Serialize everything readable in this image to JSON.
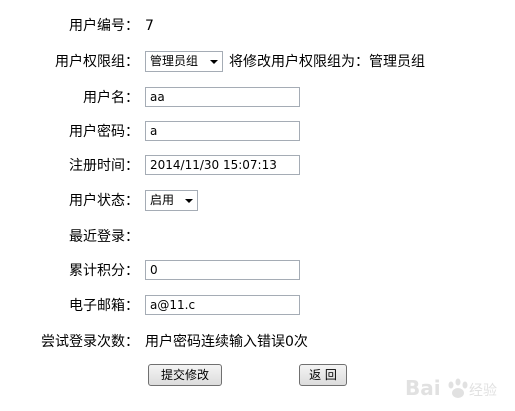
{
  "form": {
    "user_id": {
      "label": "用户编号：",
      "value": "7"
    },
    "permission_group": {
      "label": "用户权限组：",
      "selected": "管理员组",
      "note": "将修改用户权限组为：管理员组"
    },
    "username": {
      "label": "用户名：",
      "value": "aa"
    },
    "password": {
      "label": "用户密码：",
      "value": "a"
    },
    "register_time": {
      "label": "注册时间：",
      "value": "2014/11/30 15:07:13"
    },
    "status": {
      "label": "用户状态：",
      "selected": "启用"
    },
    "last_login": {
      "label": "最近登录：",
      "value": ""
    },
    "points": {
      "label": "累计积分：",
      "value": "0"
    },
    "email": {
      "label": "电子邮箱：",
      "value": "a@11.c"
    },
    "login_attempts": {
      "label": "尝试登录次数：",
      "value": "用户密码连续输入错误0次"
    }
  },
  "buttons": {
    "submit_label": "提交修改",
    "back_label": "返 回"
  },
  "watermark": {
    "brand": "Bai du",
    "sub": "经验"
  }
}
